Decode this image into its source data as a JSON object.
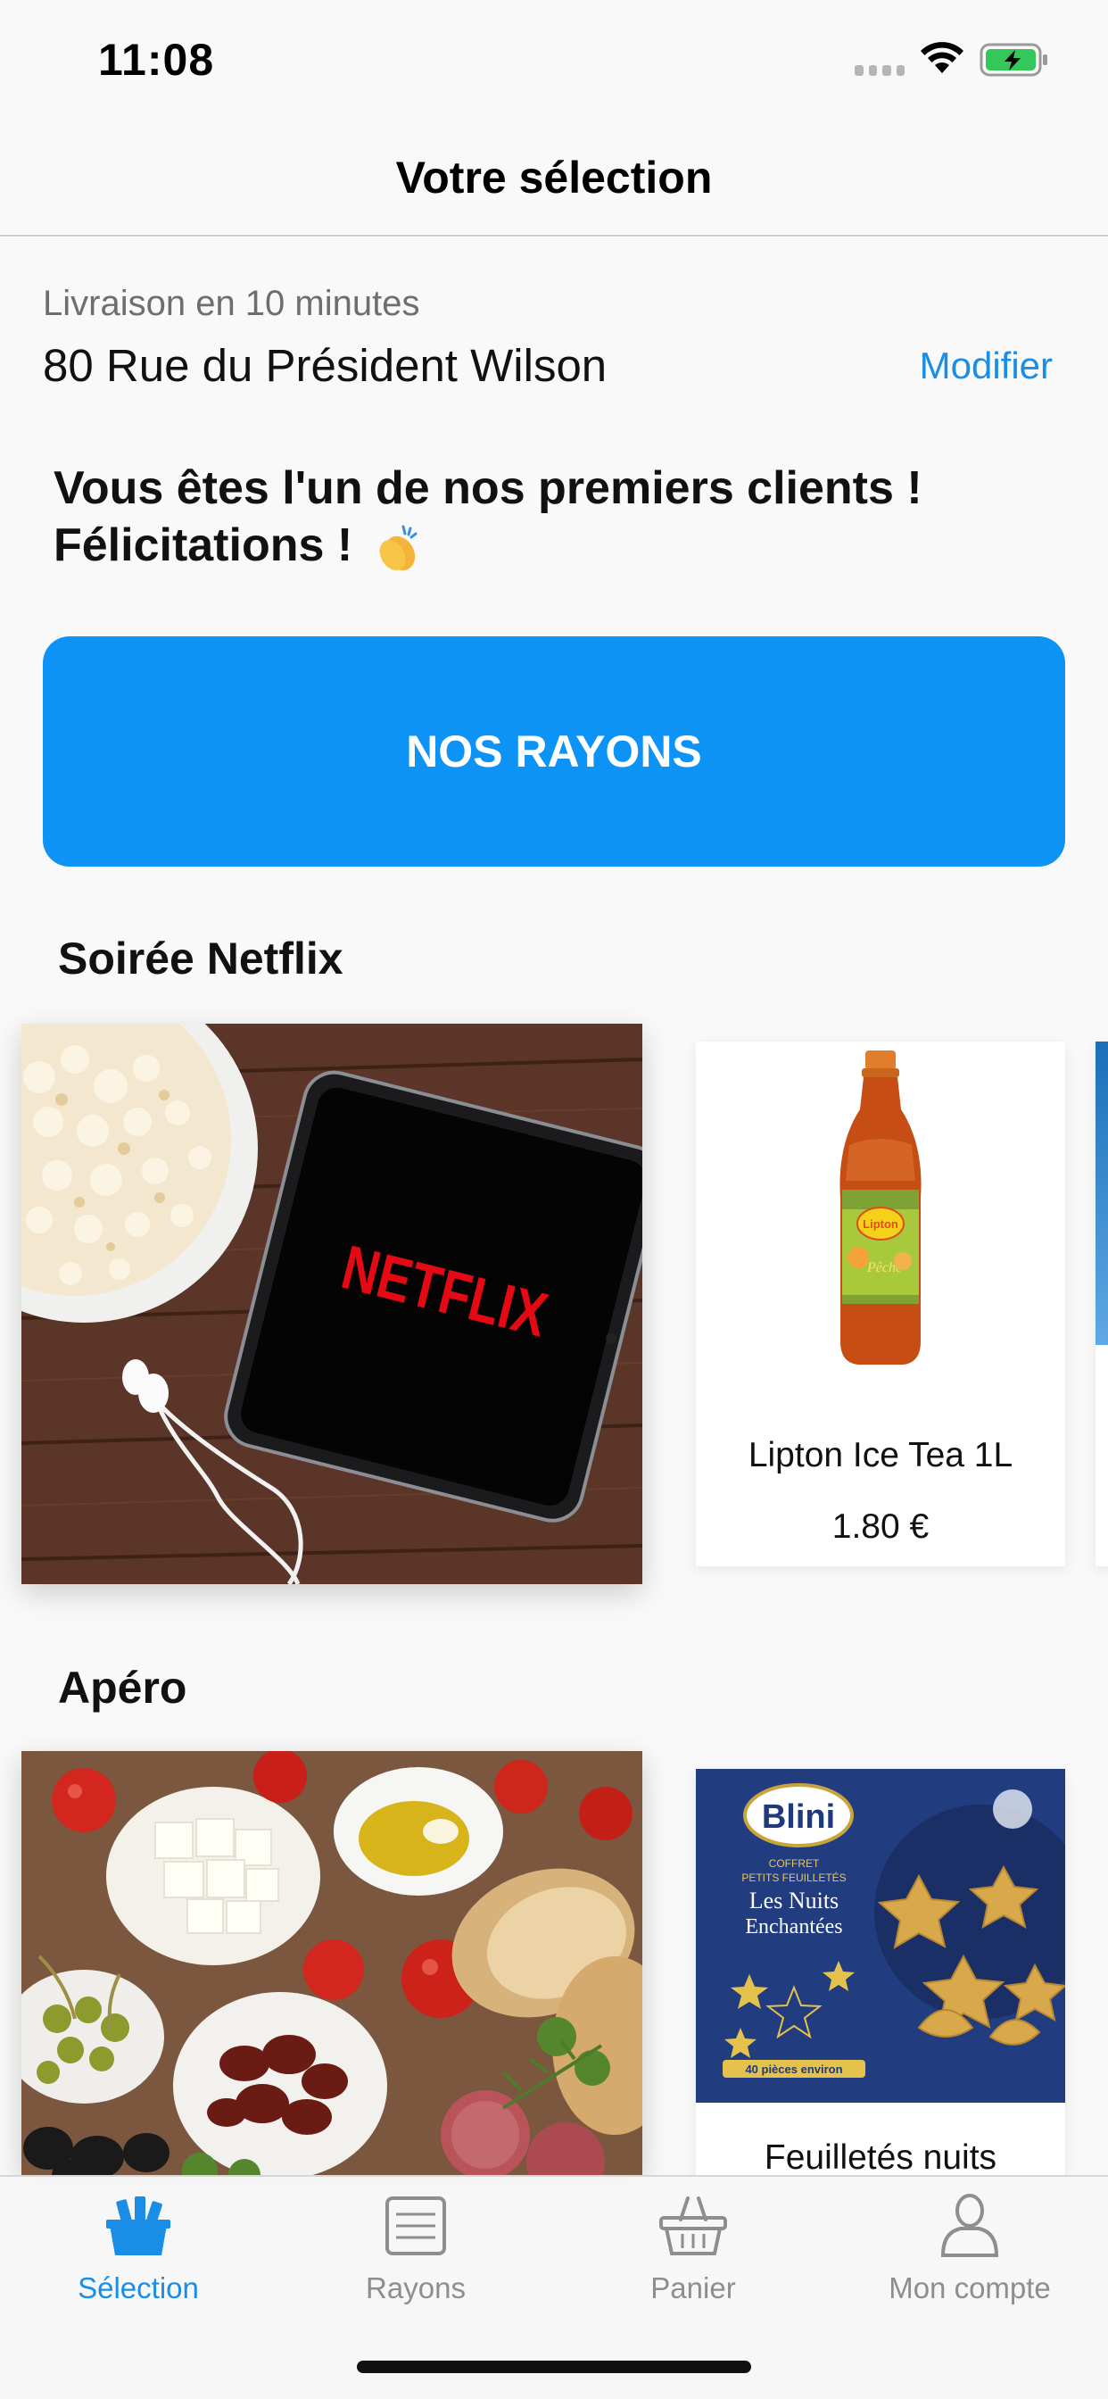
{
  "status_bar": {
    "time": "11:08"
  },
  "header": {
    "title": "Votre sélection"
  },
  "delivery": {
    "label": "Livraison en 10 minutes",
    "address": "80 Rue du Président Wilson",
    "modify_label": "Modifier"
  },
  "welcome": {
    "line1": "Vous êtes l'un de nos premiers clients !",
    "line2": "Félicitations !"
  },
  "cta": {
    "label": "NOS RAYONS"
  },
  "sections": [
    {
      "title": "Soirée Netflix",
      "hero_text": "NETFLIX",
      "product": {
        "name": "Lipton Ice Tea 1L",
        "price": "1.80 €",
        "brand": "Lipton",
        "flavor": "Pêche"
      }
    },
    {
      "title": "Apéro",
      "product": {
        "name": "Feuilletés nuits",
        "brand": "Blini",
        "box_line1": "COFFRET",
        "box_line2": "PETITS FEUILLETÉS",
        "box_line3": "Les Nuits",
        "box_line4": "Enchantées",
        "box_count": "40 pièces environ"
      }
    }
  ],
  "tab_bar": {
    "items": [
      {
        "label": "Sélection",
        "icon": "selection-icon",
        "active": true
      },
      {
        "label": "Rayons",
        "icon": "list-icon",
        "active": false
      },
      {
        "label": "Panier",
        "icon": "basket-icon",
        "active": false
      },
      {
        "label": "Mon compte",
        "icon": "user-icon",
        "active": false
      }
    ]
  },
  "colors": {
    "accent": "#0d93f5",
    "link": "#1a8ee6",
    "inactive_tab": "#8e8e8e",
    "netflix_red": "#e50914"
  }
}
